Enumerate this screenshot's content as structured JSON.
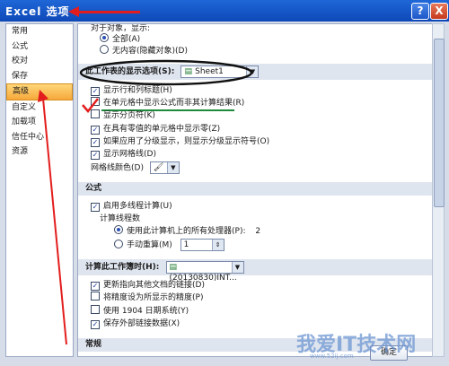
{
  "window": {
    "title": "Excel 选项",
    "help_glyph": "?",
    "close_glyph": "X"
  },
  "sidebar": {
    "items": [
      {
        "label": "常用",
        "active": false
      },
      {
        "label": "公式",
        "active": false
      },
      {
        "label": "校对",
        "active": false
      },
      {
        "label": "保存",
        "active": false
      },
      {
        "label": "高级",
        "active": true
      },
      {
        "label": "自定义",
        "active": false
      },
      {
        "label": "加载项",
        "active": false
      },
      {
        "label": "信任中心",
        "active": false
      },
      {
        "label": "资源",
        "active": false
      }
    ]
  },
  "objects": {
    "heading": "对于对象，显示:",
    "all": "全部(A)",
    "none": "无内容(隐藏对象)(D)"
  },
  "worksheet_display": {
    "label": "此工作表的显示选项(S):",
    "sheet": "Sheet1",
    "options": [
      {
        "label": "显示行和列标题(H)",
        "checked": true
      },
      {
        "label": "在单元格中显示公式而非其计算结果(R)",
        "checked": false
      },
      {
        "label": "显示分页符(K)",
        "checked": false
      },
      {
        "label": "在具有零值的单元格中显示零(Z)",
        "checked": true
      },
      {
        "label": "如果应用了分级显示，则显示分级显示符号(O)",
        "checked": true
      },
      {
        "label": "显示网格线(D)",
        "checked": true
      }
    ],
    "gridline_color_label": "网格线颜色(D)"
  },
  "formulas": {
    "section": "公式",
    "multithread": "启用多线程计算(U)",
    "threads_label": "计算线程数",
    "use_all": "使用此计算机上的所有处理器(P):",
    "processors": "2",
    "manual": "手动重算(M)",
    "manual_value": "1"
  },
  "workbook": {
    "label": "计算此工作簿时(H):",
    "file": "(20130830)INT...",
    "options": [
      {
        "label": "更新指向其他文档的链接(D)",
        "checked": true
      },
      {
        "label": "将精度设为所显示的精度(P)",
        "checked": false
      },
      {
        "label": "使用 1904 日期系统(Y)",
        "checked": false
      },
      {
        "label": "保存外部链接数据(X)",
        "checked": true
      }
    ]
  },
  "general_section": "常规",
  "ok_label": "确定",
  "watermark": "我爱IT技术网",
  "watermark_small": "www.52ij.com"
}
